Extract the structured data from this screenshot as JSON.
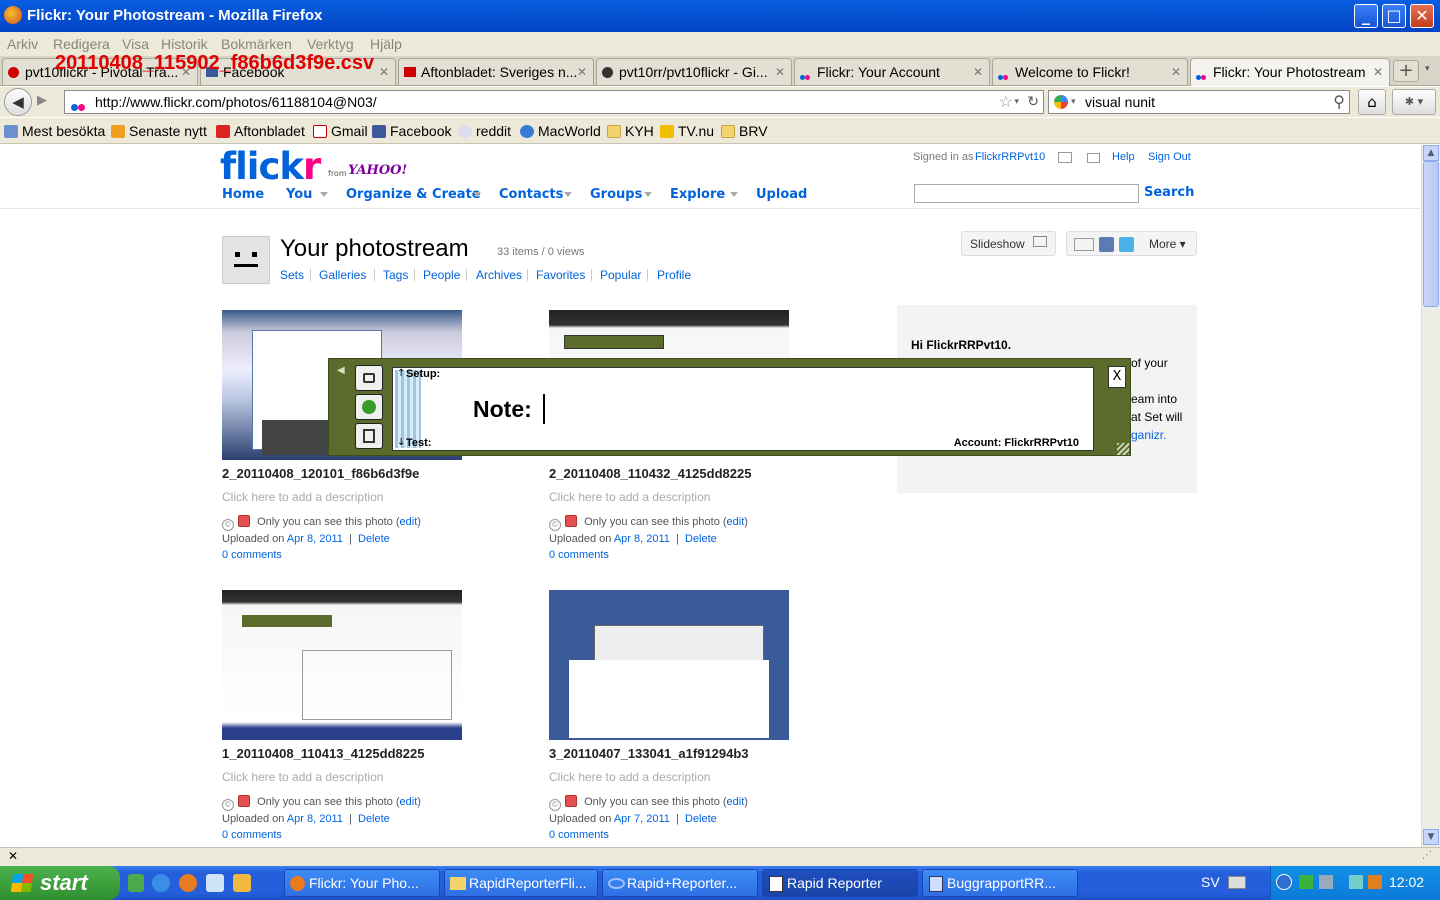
{
  "window": {
    "title": "Flickr: Your Photostream - Mozilla Firefox"
  },
  "menu": [
    "Arkiv",
    "Redigera",
    "Visa",
    "Historik",
    "Bokmärken",
    "Verktyg",
    "Hjälp"
  ],
  "overlay_text": "20110408_115902_f86b6d3f9e.csv",
  "tabs": [
    {
      "label": "pvt10flickr - Pivotal Tra..."
    },
    {
      "label": "Facebook"
    },
    {
      "label": "Aftonbladet: Sveriges n..."
    },
    {
      "label": "pvt10rr/pvt10flickr - Gi..."
    },
    {
      "label": "Flickr: Your Account"
    },
    {
      "label": "Welcome to Flickr!"
    },
    {
      "label": "Flickr: Your Photostream"
    }
  ],
  "url": "http://www.flickr.com/photos/61188104@N03/",
  "search": "visual nunit",
  "bookmarks": [
    "Mest besökta",
    "Senaste nytt",
    "Aftonbladet",
    "Gmail",
    "Facebook",
    "reddit",
    "MacWorld",
    "KYH",
    "TV.nu",
    "BRV"
  ],
  "flickr": {
    "logo_a": "flick",
    "logo_b": "r",
    "from": "from",
    "yahoo": "YAHOO!",
    "signed_in_prefix": "Signed in as",
    "user": "FlickrRRPvt10",
    "help": "Help",
    "signout": "Sign Out",
    "search_btn": "Search",
    "nav": [
      "Home",
      "You",
      "Organize & Create",
      "Contacts",
      "Groups",
      "Explore",
      "Upload"
    ],
    "title": "Your photostream",
    "stats": "33 items / 0 views",
    "subnav": [
      "Sets",
      "Galleries",
      "Tags",
      "People",
      "Archives",
      "Favorites",
      "Popular",
      "Profile"
    ],
    "slideshow": "Slideshow",
    "more": "More"
  },
  "photos": [
    {
      "title": "2_20110408_120101_f86b6d3f9e",
      "desc": "Click here to add a description",
      "privacy": "Only you can see this photo",
      "edit": "edit",
      "uploaded": "Uploaded on",
      "date": "Apr 8, 2011",
      "delete": "Delete",
      "comments": "0 comments"
    },
    {
      "title": "2_20110408_110432_4125dd8225",
      "desc": "Click here to add a description",
      "privacy": "Only you can see this photo",
      "edit": "edit",
      "uploaded": "Uploaded on",
      "date": "Apr 8, 2011",
      "delete": "Delete",
      "comments": "0 comments"
    },
    {
      "title": "1_20110408_110413_4125dd8225",
      "desc": "Click here to add a description",
      "privacy": "Only you can see this photo",
      "edit": "edit",
      "uploaded": "Uploaded on",
      "date": "Apr 8, 2011",
      "delete": "Delete",
      "comments": "0 comments"
    },
    {
      "title": "3_20110407_133041_a1f91294b3",
      "desc": "Click here to add a description",
      "privacy": "Only you can see this photo",
      "edit": "edit",
      "uploaded": "Uploaded on",
      "date": "Apr 7, 2011",
      "delete": "Delete",
      "comments": "0 comments"
    }
  ],
  "sidebar": {
    "greeting": "Hi FlickrRRPvt10.",
    "line1": "of your",
    "line2": "eam into",
    "line3": "at Set will",
    "line4": "ganizr."
  },
  "rapid_reporter": {
    "setup": "Setup:",
    "note": "Note:",
    "test": "Test:",
    "account": "Account: FlickrRRPvt10",
    "close": "X"
  },
  "taskbar": {
    "start": "start",
    "items": [
      "Flickr: Your Pho...",
      "RapidReporterFli...",
      "Rapid+Reporter...",
      "Rapid Reporter",
      "BuggrapportRR..."
    ],
    "lang": "SV",
    "clock": "12:02"
  }
}
